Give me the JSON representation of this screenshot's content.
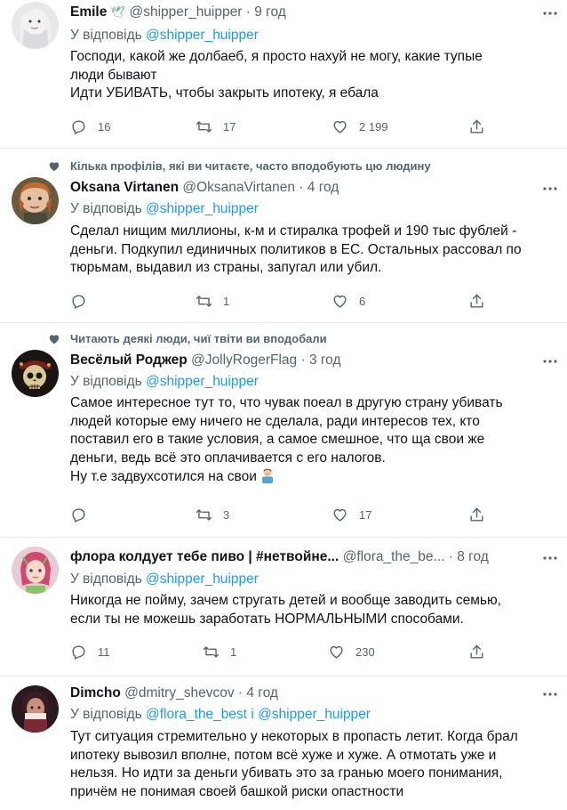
{
  "tweets": [
    {
      "name": "Emile",
      "name_badge": "🕊",
      "handle": "@shipper_huipper",
      "dot": "·",
      "time": "9 год",
      "reply_prefix": "У відповідь",
      "reply_to": "@shipper_huipper",
      "reply_and": "",
      "reply_to2": "",
      "lines": [
        "Господи, какой же долбаеб, я просто нахуй не могу, какие тупые",
        "люди бывают",
        "Идти УБИВАТЬ, чтобы закрыть ипотеку, я ебала"
      ],
      "replies": "16",
      "retweets": "17",
      "likes": "2 199"
    },
    {
      "context": "Кілька профілів, які ви читаєте, часто вподобують цю людину",
      "name": "Oksana Virtanen",
      "handle": "@OksanaVirtanen",
      "dot": "·",
      "time": "4 год",
      "reply_prefix": "У відповідь",
      "reply_to": "@shipper_huipper",
      "lines": [
        "Сделал нищим миллионы, к-м и стиралка трофей и 190 тыс фублей -",
        "деньги. Подкупил единичных политиков в ЕС. Остальных рассовал по",
        "тюрьмам, выдавил из страны, запугал или убил."
      ],
      "replies": "",
      "retweets": "1",
      "likes": "6"
    },
    {
      "context": "Читають деякі люди, чиї твіти ви вподобали",
      "name": "Весёлый Роджер",
      "handle": "@JollyRogerFlag",
      "dot": "·",
      "time": "3 год",
      "reply_prefix": "У відповідь",
      "reply_to": "@shipper_huipper",
      "lines": [
        "Самое интересное тут то, что чувак поеал в другую страну убивать",
        "людей которые ему ничего не сделала, ради интересов тех, кто",
        "поставил его в такие условия, а самое смешное, что ща свои же",
        "деньги, ведь всё это оплачивается с его налогов.",
        "Ну т.е задвухсотился на свои"
      ],
      "replies": "",
      "retweets": "3",
      "likes": "17"
    },
    {
      "name": "флора колдует тебе пиво | #нетвойне...",
      "handle": "@flora_the_be...",
      "dot": "·",
      "time": "8 год",
      "reply_prefix": "У відповідь",
      "reply_to": "@shipper_huipper",
      "lines": [
        "Никогда не пойму, зачем стругать детей и вообще заводить семью,",
        "если ты не можешь заработать НОРМАЛЬНЫМИ способами."
      ],
      "replies": "11",
      "retweets": "1",
      "likes": "230"
    },
    {
      "name": "Dimcho",
      "handle": "@dmitry_shevcov",
      "dot": "·",
      "time": "4 год",
      "reply_prefix": "У відповідь",
      "reply_to": "@flora_the_best",
      "reply_and": "і",
      "reply_to2": "@shipper_huipper",
      "lines": [
        "Тут ситуация стремительно у некоторых в пропасть летит. Когда брал",
        "ипотеку вывозил вполне, потом всё хуже и хуже. А отмотать уже и",
        "нельзя. Но идти за деньги убивать это за гранью моего понимания,",
        "причём не понимая своей башкой риски опастности"
      ]
    }
  ],
  "icon_names": [
    "reply-icon",
    "retweet-icon",
    "like-icon",
    "share-icon",
    "more-icon",
    "heart-context-icon"
  ],
  "colors": {
    "link": "#1d9bf0",
    "secondary": "#536471",
    "text": "#0f1419",
    "divider": "#e7e9ea"
  }
}
